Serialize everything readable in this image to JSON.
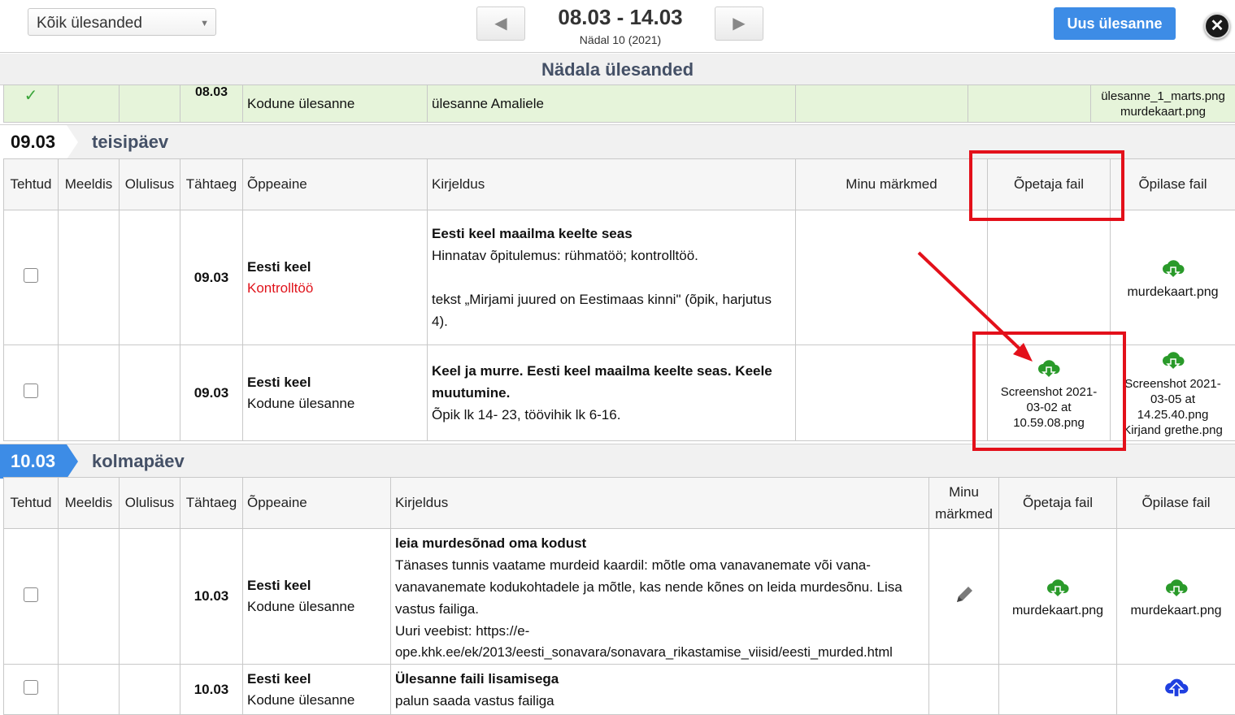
{
  "toolbar": {
    "filter_value": "Kõik ülesanded",
    "prev_label": "◀",
    "next_label": "▶",
    "week_range": "08.03 - 14.03",
    "week_info": "Nädal 10  (2021)",
    "new_task_label": "Uus ülesanne",
    "close_label": "✕"
  },
  "week_header": "Nädala ülesanded",
  "prev_row": {
    "date": "08.03",
    "subject": "Kodune ülesanne",
    "description": "ülesanne Amaliele",
    "student_file_1": "ülesanne_1_marts.png",
    "student_file_2": "murdekaart.png"
  },
  "columns": {
    "done": "Tehtud",
    "liked": "Meeldis",
    "importance": "Olulisus",
    "deadline": "Tähtaeg",
    "subject": "Õppeaine",
    "description": "Kirjeldus",
    "my_notes": "Minu märkmed",
    "my_notes_short_1": "Minu",
    "my_notes_short_2": "märkmed",
    "teacher_file": "Õpetaja fail",
    "student_file": "Õpilase fail"
  },
  "day1": {
    "date": "09.03",
    "name": "teisipäev",
    "rows": [
      {
        "deadline": "09.03",
        "subject": "Eesti keel",
        "type": "Kontrolltöö",
        "title": "Eesti keel maailma keelte seas",
        "line1": "Hinnatav õpitulemus: rühmatöö; kontrolltöö.",
        "line2": "tekst „Mirjami juured on Eestimaas kinni\" (õpik, harjutus",
        "line3": "4).",
        "student_file": "murdekaart.png"
      },
      {
        "deadline": "09.03",
        "subject": "Eesti keel",
        "type": "Kodune ülesanne",
        "title1": "Keel ja murre. Eesti keel maailma keelte seas. Keele",
        "title2": "muutumine.",
        "line1": "Õpik lk 14- 23, töövihik lk 6-16.",
        "teacher_file_1": "Screenshot 2021-",
        "teacher_file_2": "03-02 at",
        "teacher_file_3": "10.59.08.png",
        "student_file_1": "Screenshot 2021-",
        "student_file_2": "03-05 at",
        "student_file_3": "14.25.40.png",
        "student_file_4": "Kirjand grethe.png"
      }
    ]
  },
  "day2": {
    "date": "10.03",
    "name": "kolmapäev",
    "rows": [
      {
        "deadline": "10.03",
        "subject": "Eesti keel",
        "type": "Kodune ülesanne",
        "title": "leia murdesõnad oma kodust",
        "line1": "Tänases tunnis vaatame murdeid kaardil: mõtle oma vanavanemate või vana-",
        "line2": "vanavanemate kodukohtadele ja mõtle, kas nende kõnes on leida murdesõnu. Lisa",
        "line3": "vastus failiga.",
        "line4": "Uuri veebist: https://e-",
        "line5": "ope.khk.ee/ek/2013/eesti_sonavara/sonavara_rikastamise_viisid/eesti_murded.html",
        "teacher_file": "murdekaart.png",
        "student_file": "murdekaart.png"
      },
      {
        "deadline": "10.03",
        "subject": "Eesti keel",
        "type": "Kodune ülesanne",
        "title": "Ülesanne faili lisamisega",
        "line1": "palun saada vastus failiga"
      }
    ]
  },
  "colors": {
    "accent_blue": "#3d8ce6",
    "download_green": "#2a9a2a",
    "upload_blue": "#1f3fe0",
    "annotation_red": "#e3101a",
    "done_row_green": "#e6f4da"
  }
}
